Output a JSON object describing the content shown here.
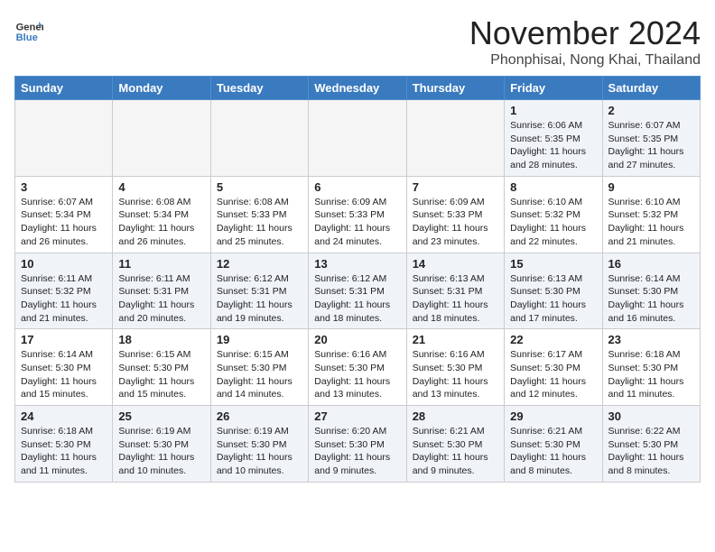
{
  "header": {
    "logo_general": "General",
    "logo_blue": "Blue",
    "month_title": "November 2024",
    "location": "Phonphisai, Nong Khai, Thailand"
  },
  "weekdays": [
    "Sunday",
    "Monday",
    "Tuesday",
    "Wednesday",
    "Thursday",
    "Friday",
    "Saturday"
  ],
  "weeks": [
    [
      {
        "day": "",
        "empty": true
      },
      {
        "day": "",
        "empty": true
      },
      {
        "day": "",
        "empty": true
      },
      {
        "day": "",
        "empty": true
      },
      {
        "day": "",
        "empty": true
      },
      {
        "day": "1",
        "sunrise": "6:06 AM",
        "sunset": "5:35 PM",
        "daylight": "11 hours and 28 minutes."
      },
      {
        "day": "2",
        "sunrise": "6:07 AM",
        "sunset": "5:35 PM",
        "daylight": "11 hours and 27 minutes."
      }
    ],
    [
      {
        "day": "3",
        "sunrise": "6:07 AM",
        "sunset": "5:34 PM",
        "daylight": "11 hours and 26 minutes."
      },
      {
        "day": "4",
        "sunrise": "6:08 AM",
        "sunset": "5:34 PM",
        "daylight": "11 hours and 26 minutes."
      },
      {
        "day": "5",
        "sunrise": "6:08 AM",
        "sunset": "5:33 PM",
        "daylight": "11 hours and 25 minutes."
      },
      {
        "day": "6",
        "sunrise": "6:09 AM",
        "sunset": "5:33 PM",
        "daylight": "11 hours and 24 minutes."
      },
      {
        "day": "7",
        "sunrise": "6:09 AM",
        "sunset": "5:33 PM",
        "daylight": "11 hours and 23 minutes."
      },
      {
        "day": "8",
        "sunrise": "6:10 AM",
        "sunset": "5:32 PM",
        "daylight": "11 hours and 22 minutes."
      },
      {
        "day": "9",
        "sunrise": "6:10 AM",
        "sunset": "5:32 PM",
        "daylight": "11 hours and 21 minutes."
      }
    ],
    [
      {
        "day": "10",
        "sunrise": "6:11 AM",
        "sunset": "5:32 PM",
        "daylight": "11 hours and 21 minutes."
      },
      {
        "day": "11",
        "sunrise": "6:11 AM",
        "sunset": "5:31 PM",
        "daylight": "11 hours and 20 minutes."
      },
      {
        "day": "12",
        "sunrise": "6:12 AM",
        "sunset": "5:31 PM",
        "daylight": "11 hours and 19 minutes."
      },
      {
        "day": "13",
        "sunrise": "6:12 AM",
        "sunset": "5:31 PM",
        "daylight": "11 hours and 18 minutes."
      },
      {
        "day": "14",
        "sunrise": "6:13 AM",
        "sunset": "5:31 PM",
        "daylight": "11 hours and 18 minutes."
      },
      {
        "day": "15",
        "sunrise": "6:13 AM",
        "sunset": "5:30 PM",
        "daylight": "11 hours and 17 minutes."
      },
      {
        "day": "16",
        "sunrise": "6:14 AM",
        "sunset": "5:30 PM",
        "daylight": "11 hours and 16 minutes."
      }
    ],
    [
      {
        "day": "17",
        "sunrise": "6:14 AM",
        "sunset": "5:30 PM",
        "daylight": "11 hours and 15 minutes."
      },
      {
        "day": "18",
        "sunrise": "6:15 AM",
        "sunset": "5:30 PM",
        "daylight": "11 hours and 15 minutes."
      },
      {
        "day": "19",
        "sunrise": "6:15 AM",
        "sunset": "5:30 PM",
        "daylight": "11 hours and 14 minutes."
      },
      {
        "day": "20",
        "sunrise": "6:16 AM",
        "sunset": "5:30 PM",
        "daylight": "11 hours and 13 minutes."
      },
      {
        "day": "21",
        "sunrise": "6:16 AM",
        "sunset": "5:30 PM",
        "daylight": "11 hours and 13 minutes."
      },
      {
        "day": "22",
        "sunrise": "6:17 AM",
        "sunset": "5:30 PM",
        "daylight": "11 hours and 12 minutes."
      },
      {
        "day": "23",
        "sunrise": "6:18 AM",
        "sunset": "5:30 PM",
        "daylight": "11 hours and 11 minutes."
      }
    ],
    [
      {
        "day": "24",
        "sunrise": "6:18 AM",
        "sunset": "5:30 PM",
        "daylight": "11 hours and 11 minutes."
      },
      {
        "day": "25",
        "sunrise": "6:19 AM",
        "sunset": "5:30 PM",
        "daylight": "11 hours and 10 minutes."
      },
      {
        "day": "26",
        "sunrise": "6:19 AM",
        "sunset": "5:30 PM",
        "daylight": "11 hours and 10 minutes."
      },
      {
        "day": "27",
        "sunrise": "6:20 AM",
        "sunset": "5:30 PM",
        "daylight": "11 hours and 9 minutes."
      },
      {
        "day": "28",
        "sunrise": "6:21 AM",
        "sunset": "5:30 PM",
        "daylight": "11 hours and 9 minutes."
      },
      {
        "day": "29",
        "sunrise": "6:21 AM",
        "sunset": "5:30 PM",
        "daylight": "11 hours and 8 minutes."
      },
      {
        "day": "30",
        "sunrise": "6:22 AM",
        "sunset": "5:30 PM",
        "daylight": "11 hours and 8 minutes."
      }
    ]
  ]
}
